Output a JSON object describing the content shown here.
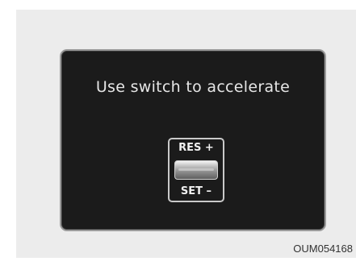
{
  "display": {
    "message": "Use switch to accelerate",
    "switch": {
      "top_label": "RES +",
      "bottom_label": "SET –"
    }
  },
  "caption": "OUM054168",
  "colors": {
    "screen_background": "#1b1b1b",
    "panel_background": "#ececec",
    "screen_border": "#9a9a9a",
    "text": "#e6e6e6"
  },
  "icons": {
    "switch": "res-set-rocker-switch-icon"
  }
}
